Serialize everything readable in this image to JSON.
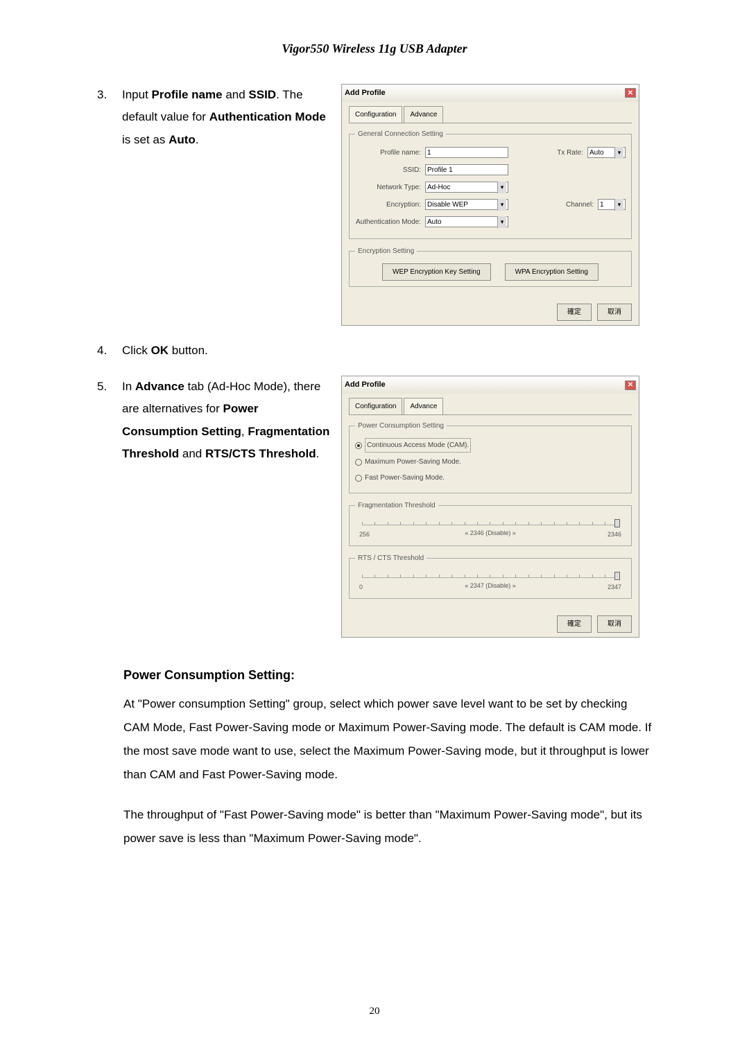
{
  "header": "Vigor550 Wireless 11g USB Adapter",
  "step3": {
    "num": "3.",
    "text": "Input <b>Profile name</b> and <b>SSID</b>. The default value for <b>Authentication Mode</b> is set as <b>Auto</b>."
  },
  "step4": {
    "num": "4.",
    "text": "Click <b>OK</b> button."
  },
  "step5": {
    "num": "5.",
    "text": "In <b>Advance</b> tab (Ad-Hoc Mode), there are alternatives for <b>Power Consumption Setting</b>, <b>Fragmentation Threshold</b> and <b>RTS/CTS Threshold</b>."
  },
  "dialog1": {
    "title": "Add Profile",
    "tab_config": "Configuration",
    "tab_advance": "Advance",
    "gcs": "General Connection Setting",
    "profile_label": "Profile name:",
    "profile_value": "1",
    "txrate_label": "Tx Rate:",
    "txrate_value": "Auto",
    "ssid_label": "SSID:",
    "ssid_value": "Profile 1",
    "nettype_label": "Network Type:",
    "nettype_value": "Ad-Hoc",
    "enc_label": "Encryption:",
    "enc_value": "Disable WEP",
    "channel_label": "Channel:",
    "channel_value": "1",
    "auth_label": "Authentication Mode:",
    "auth_value": "Auto",
    "es": "Encryption Setting",
    "wep_btn": "WEP Encryption Key Setting",
    "wpa_btn": "WPA Encryption Setting",
    "ok": "確定",
    "cancel": "取消"
  },
  "dialog2": {
    "title": "Add Profile",
    "tab_config": "Configuration",
    "tab_advance": "Advance",
    "pcs": "Power Consumption Setting",
    "r1": "Continuous Access Mode (CAM).",
    "r2": "Maximum Power-Saving Mode.",
    "r3": "Fast Power-Saving Mode.",
    "frag_legend": "Fragmentation Threshold",
    "frag_min": "256",
    "frag_lbl": "« 2346 (Disable) »",
    "frag_max": "2346",
    "rts_legend": "RTS / CTS Threshold",
    "rts_min": "0",
    "rts_lbl": "« 2347 (Disable) »",
    "rts_max": "2347",
    "ok": "確定",
    "cancel": "取消"
  },
  "pcs_heading": "Power Consumption Setting:",
  "pcs_para1": "At \"Power consumption Setting\" group, select which power save level want to be set by checking CAM Mode, Fast Power-Saving mode or Maximum Power-Saving mode. The default is CAM mode. If the most save mode want to use, select the Maximum Power-Saving mode, but it throughput is lower than CAM and Fast Power-Saving mode.",
  "pcs_para2": "The throughput of \"Fast Power-Saving mode\" is better than \"Maximum Power-Saving mode\", but its power save is less than \"Maximum Power-Saving mode\".",
  "page_number": "20"
}
